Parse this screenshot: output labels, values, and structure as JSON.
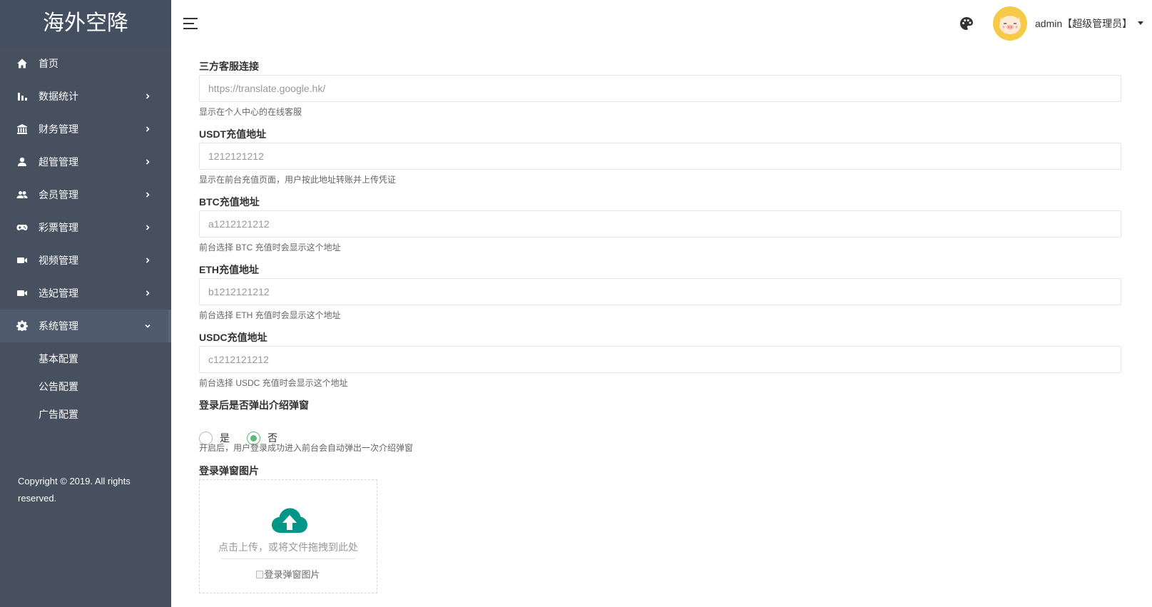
{
  "app": {
    "logo_text": "海外空降"
  },
  "sidebar": {
    "items": [
      {
        "label": "首页",
        "icon": "home-icon"
      },
      {
        "label": "数据统计",
        "icon": "bar-chart-icon"
      },
      {
        "label": "财务管理",
        "icon": "bank-icon"
      },
      {
        "label": "超管管理",
        "icon": "user-icon"
      },
      {
        "label": "会员管理",
        "icon": "group-icon"
      },
      {
        "label": "彩票管理",
        "icon": "gamepad-icon"
      },
      {
        "label": "视频管理",
        "icon": "video-icon"
      },
      {
        "label": "选妃管理",
        "icon": "video-icon"
      },
      {
        "label": "系统管理",
        "icon": "gear-icon"
      }
    ],
    "subitems": [
      "基本配置",
      "公告配置",
      "广告配置"
    ],
    "copyright": "Copyright © 2019. All rights reserved."
  },
  "header": {
    "user_label": "admin【超级管理员】"
  },
  "form": {
    "service": {
      "label": "三方客服连接",
      "value": "https://translate.google.hk/",
      "help": "显示在个人中心的在线客服"
    },
    "usdt": {
      "label": "USDT充值地址",
      "value": "1212121212",
      "help": "显示在前台充值页面，用户按此地址转账并上传凭证"
    },
    "btc": {
      "label": "BTC充值地址",
      "value": "a1212121212",
      "help": "前台选择 BTC 充值时会显示这个地址"
    },
    "eth": {
      "label": "ETH充值地址",
      "value": "b1212121212",
      "help": "前台选择 ETH 充值时会显示这个地址"
    },
    "usdc": {
      "label": "USDC充值地址",
      "value": "c1212121212",
      "help": "前台选择 USDC 充值时会显示这个地址"
    },
    "popup": {
      "label": "登录后是否弹出介绍弹窗",
      "option_yes": "是",
      "option_no": "否",
      "selected": "否",
      "help": "开启后，用户登录成功进入前台会自动弹出一次介绍弹窗"
    },
    "popup_image": {
      "label": "登录弹窗图片",
      "upload_text": "点击上传，或将文件拖拽到此处",
      "image_alt": "登录弹窗图片"
    }
  },
  "colors": {
    "sidebar_bg": "#46505f",
    "accent_green": "#5fb878",
    "upload_icon": "#009688",
    "avatar_bg": "#f7c949"
  }
}
